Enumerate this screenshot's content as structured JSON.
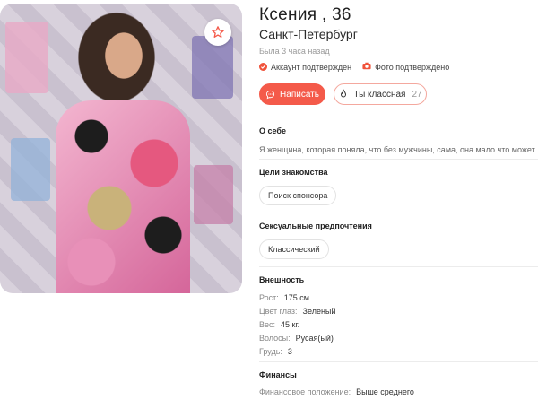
{
  "profile": {
    "name": "Ксения , 36",
    "city": "Санкт-Петербург",
    "last_seen": "Была 3 часа назад",
    "badges": {
      "account": "Аккаунт подтвержден",
      "photo": "Фото подтверждено"
    }
  },
  "actions": {
    "write_label": "Написать",
    "like_label": "Ты классная",
    "like_count": "27"
  },
  "about": {
    "title": "О себе",
    "text": "Я женщина, которая поняла, что без мужчины, сама, она мало что может."
  },
  "goals": {
    "title": "Цели знакомства",
    "tag": "Поиск спонсора"
  },
  "sexual": {
    "title": "Сексуальные предпочтения",
    "tag": "Классический"
  },
  "appearance": {
    "title": "Внешность",
    "rows": [
      {
        "label": "Рост:",
        "value": "175 см."
      },
      {
        "label": "Цвет глаз:",
        "value": "Зеленый"
      },
      {
        "label": "Вес:",
        "value": "45 кг."
      },
      {
        "label": "Волосы:",
        "value": "Русая(ый)"
      },
      {
        "label": "Грудь:",
        "value": "3"
      }
    ]
  },
  "finance": {
    "title": "Финансы",
    "rows": [
      {
        "label": "Финансовое положение:",
        "value": "Выше среднего"
      }
    ]
  },
  "colors": {
    "accent": "#f45a4a",
    "badge": "#f0533b"
  },
  "icons": {
    "favorite": "star-icon",
    "write": "chat-icon",
    "like": "flame-icon",
    "verified": "check-icon",
    "photo_verified": "camera-icon"
  }
}
